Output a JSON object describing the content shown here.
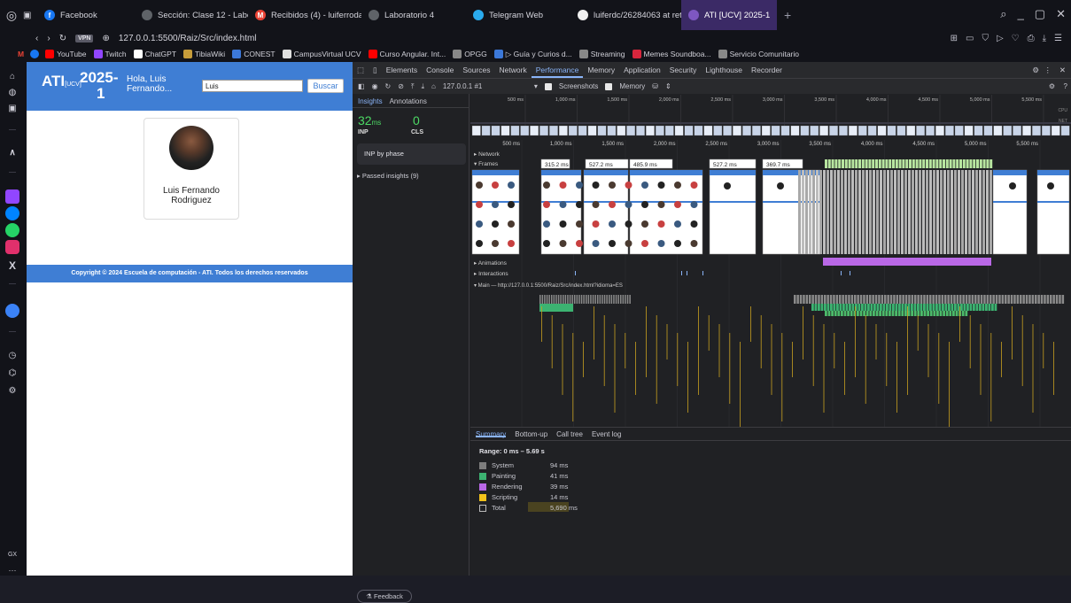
{
  "browser": {
    "tabs": [
      {
        "label": "Facebook",
        "color": "#1877f2",
        "glyph": "f"
      },
      {
        "label": "Sección: Clase 12 - Labo",
        "color": "#5f6368",
        "glyph": ""
      },
      {
        "label": "Recibidos (4) - luiferroda",
        "color": "#ea4335",
        "glyph": "M"
      },
      {
        "label": "Laboratorio 4",
        "color": "#5f6368",
        "glyph": ""
      },
      {
        "label": "Telegram Web",
        "color": "#2aabee",
        "glyph": ""
      },
      {
        "label": "luiferdc/26284063 at reto",
        "color": "#f0f0f0",
        "glyph": ""
      },
      {
        "label": "ATI [UCV] 2025-1",
        "color": "#7e57c2",
        "glyph": ""
      }
    ],
    "address": "127.0.0.1:5500/Raiz/Src/index.html",
    "vpn": "VPN",
    "bookmarks": [
      {
        "label": "YouTube",
        "color": "#ff0000"
      },
      {
        "label": "Twitch",
        "color": "#9146ff"
      },
      {
        "label": "ChatGPT",
        "color": "#ffffff"
      },
      {
        "label": "TibiaWiki",
        "color": "#c69c3a"
      },
      {
        "label": "CONEST",
        "color": "#3c78d8"
      },
      {
        "label": "CampusVirtual UCV",
        "color": "#e0e0e0"
      },
      {
        "label": "Curso Angular. Int...",
        "color": "#ff0000"
      },
      {
        "label": "OPGG",
        "color": "#888888"
      },
      {
        "label": "▷ Guía y Curios d...",
        "color": "#3c78d8"
      },
      {
        "label": "Streaming",
        "color": "#888888"
      },
      {
        "label": "Memes Soundboa...",
        "color": "#d7263d"
      },
      {
        "label": "Servicio Comunitario",
        "color": "#888888"
      }
    ]
  },
  "site": {
    "brand": "ATI",
    "brand_sub": "[UCV]",
    "year": "2025-",
    "year2": "1",
    "greeting": "Hola, Luis Fernando...",
    "search_value": "Luis",
    "search_button": "Buscar",
    "card_name": "Luis Fernando Rodriguez",
    "footer": "Copyright © 2024 Escuela de computación - ATI. Todos los derechos reservados"
  },
  "devtools": {
    "tabs": [
      "Elements",
      "Console",
      "Sources",
      "Network",
      "Performance",
      "Memory",
      "Application",
      "Security",
      "Lighthouse",
      "Recorder"
    ],
    "active_tab": "Performance",
    "recording": "127.0.0.1 #1",
    "screenshots_label": "Screenshots",
    "memory_label": "Memory",
    "insights_tab": "Insights",
    "annotations_tab": "Annotations",
    "inp_value": "32",
    "inp_unit": "ms",
    "inp_label": "INP",
    "cls_value": "0",
    "cls_label": "CLS",
    "inp_phase": "INP by phase",
    "passed": "▸ Passed insights (9)",
    "feedback": "Feedback",
    "ruler_ticks": [
      "500 ms",
      "1,000 ms",
      "1,500 ms",
      "2,000 ms",
      "2,500 ms",
      "3,000 ms",
      "3,500 ms",
      "4,000 ms",
      "4,500 ms",
      "5,000 ms",
      "5,500 ms"
    ],
    "overview_labels": [
      "CPU",
      "NET"
    ],
    "tracks": {
      "network": "▸ Network",
      "frames": "▾ Frames",
      "animations": "▸ Animations",
      "interactions": "▸ Interactions",
      "main": "▾ Main — http://127.0.0.1:5500/Raiz/Src/index.html?idioma=ES"
    },
    "frame_durations": [
      "315.2 ms",
      "527.2 ms",
      "485.9 ms",
      "527.2 ms",
      "369.7 ms"
    ],
    "summary_tabs": [
      "Summary",
      "Bottom-up",
      "Call tree",
      "Event log"
    ],
    "range": "Range: 0 ms – 5.69 s",
    "summary_rows": [
      {
        "label": "System",
        "value": "94 ms",
        "color": "#7d7d7d"
      },
      {
        "label": "Painting",
        "value": "41 ms",
        "color": "#3cb371"
      },
      {
        "label": "Rendering",
        "value": "39 ms",
        "color": "#b968e6"
      },
      {
        "label": "Scripting",
        "value": "14 ms",
        "color": "#f2c21b"
      },
      {
        "label": "Total",
        "value": "5,690 ms",
        "color": "#202124"
      }
    ]
  }
}
